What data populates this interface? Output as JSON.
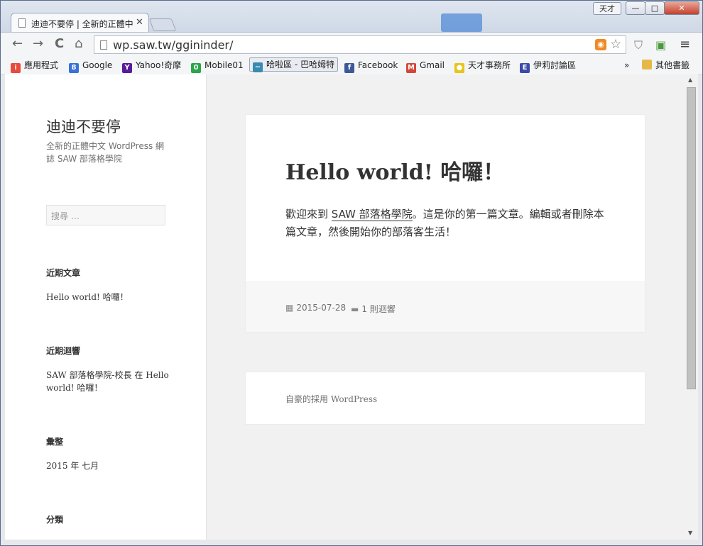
{
  "window": {
    "user_tag": "天才",
    "min": "—",
    "max": "□",
    "close": "✕"
  },
  "tab": {
    "title": "迪迪不要停 | 全新的正體中",
    "close": "✕"
  },
  "toolbar": {
    "back": "←",
    "forward": "→",
    "reload": "C",
    "home": "⌂",
    "url": "wp.saw.tw/ggininder/",
    "rss": "◉",
    "star": "☆",
    "menu": "≡"
  },
  "bookmarks": [
    {
      "label": "應用程式",
      "icon": "apps-icon",
      "color": "#e84b3c"
    },
    {
      "label": "Google",
      "icon": "google-icon",
      "color": "#3a72d8"
    },
    {
      "label": "Yahoo!奇摩",
      "icon": "yahoo-icon",
      "color": "#5a1a9a"
    },
    {
      "label": "Mobile01",
      "icon": "mobile01-icon",
      "color": "#2aa64a"
    },
    {
      "label": "哈啦區 - 巴哈姆特",
      "icon": "bahamut-icon",
      "color": "#3a8ab0"
    },
    {
      "label": "Facebook",
      "icon": "facebook-icon",
      "color": "#3b5998"
    },
    {
      "label": "Gmail",
      "icon": "gmail-icon",
      "color": "#d44638"
    },
    {
      "label": "天才事務所",
      "icon": "lightbulb-icon",
      "color": "#e8c51a"
    },
    {
      "label": "伊莉討論區",
      "icon": "eyny-icon",
      "color": "#3a4aa8"
    }
  ],
  "bookmarks_more": "»",
  "other_bookmarks": "其他書籤",
  "site": {
    "title": "迪迪不要停",
    "description": "全新的正體中文 WordPress 網誌 SAW 部落格學院",
    "search_placeholder": "搜尋 …"
  },
  "widgets": {
    "recent_posts_title": "近期文章",
    "recent_post": "Hello world! 哈囉！",
    "recent_comments_title": "近期迴響",
    "recent_comment": "SAW 部落格學院-校長 在 Hello world! 哈囉！",
    "archives_title": "彙整",
    "archive": "2015 年 七月",
    "categories_title": "分類"
  },
  "post": {
    "title": "Hello world! 哈囉！",
    "body_prefix": "歡迎來到 ",
    "body_link": "SAW 部落格學院",
    "body_suffix": "。這是你的第一篇文章。編輯或者刪除本篇文章，然後開始你的部落客生活！",
    "date": "2015-07-28",
    "comments": "1 則迴響"
  },
  "footer": {
    "credit": "自豪的採用 WordPress"
  }
}
